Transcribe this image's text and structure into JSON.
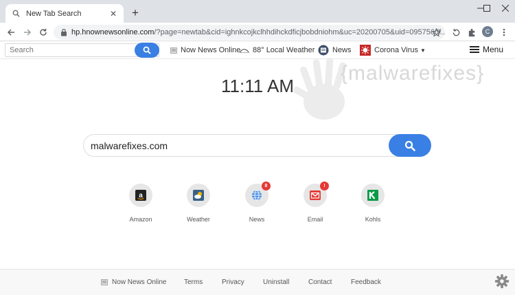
{
  "browser": {
    "tab_title": "New Tab Search",
    "url_host": "hp.hnownewsonline.com",
    "url_rest": "/?page=newtab&cid=ighnkcojkclhhdihckdficjbobdniohm&uc=20200705&uid=095756df...",
    "avatar_letter": "C"
  },
  "navbar": {
    "search_placeholder": "Search",
    "items": [
      {
        "label": "Now News Online",
        "icon": "newspaper-icon"
      },
      {
        "label": "88° Local Weather",
        "icon": "weather-icon"
      },
      {
        "label": "News",
        "icon": "news-icon"
      },
      {
        "label": "Corona Virus",
        "icon": "virus-icon"
      }
    ],
    "menu_label": "Menu"
  },
  "watermark": "{malwarefixes}",
  "clock": "11:11 AM",
  "main_search": {
    "value": "malwarefixes.com"
  },
  "shortcuts": [
    {
      "label": "Amazon",
      "badge": ""
    },
    {
      "label": "Weather",
      "badge": ""
    },
    {
      "label": "News",
      "badge": "8"
    },
    {
      "label": "Email",
      "badge": "!"
    },
    {
      "label": "Kohls",
      "badge": ""
    }
  ],
  "footer": {
    "links": [
      "Now News Online",
      "Terms",
      "Privacy",
      "Uninstall",
      "Contact",
      "Feedback"
    ]
  },
  "colors": {
    "accent": "#3a7fe4",
    "badge": "#e53935"
  }
}
